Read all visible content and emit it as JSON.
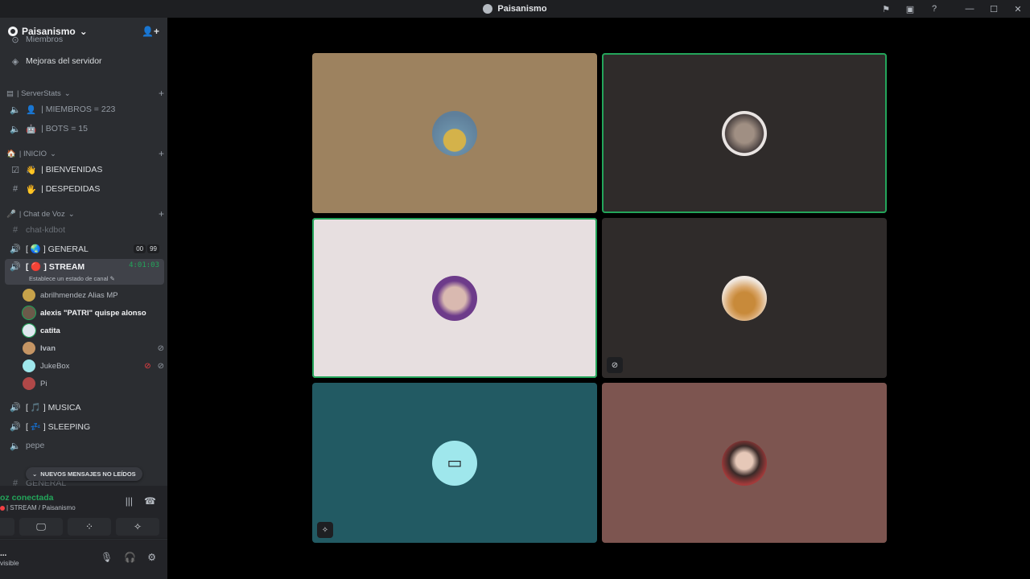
{
  "window": {
    "title": "Paisanismo"
  },
  "server": {
    "name": "Paisanismo"
  },
  "sidebar": {
    "partial_top": "Miembros",
    "boost": "Mejoras del servidor",
    "categories": {
      "serverstats": "| ServerStats",
      "inicio": "| INICIO",
      "chat_voz": "| Chat de Voz"
    },
    "channels": {
      "miembros": "| MIEMBROS = 223",
      "bots": "| BOTS = 15",
      "bienvenidas": "| BIENVENIDAS",
      "despedidas": "| DESPEDIDAS",
      "chat_kdbot": "chat-kdbot",
      "general": "[ 🌏 ] GENERAL",
      "general_badge_a": "00",
      "general_badge_b": "99",
      "stream": "[ 🔴 ] STREAM",
      "stream_timer": "4:01:03",
      "stream_status": "Establece un estado de canal",
      "musica": "[ 🎵 ] MUSICA",
      "sleeping": "[ 💤 ] SLEEPING",
      "pepe": "pepe",
      "general2": "GENERAL"
    },
    "voice_users": [
      {
        "name": "abrilhmendez Alias MP",
        "bold": false,
        "color": "#c7a24a"
      },
      {
        "name": "alexis \"PATRI\" quispe alonso",
        "bold": true,
        "color": "#6b5a4a"
      },
      {
        "name": "catita",
        "bold": true,
        "color": "#dfe7ef"
      },
      {
        "name": "Ivan",
        "bold": false,
        "color": "#c59564"
      },
      {
        "name": "JukeBox",
        "bold": false,
        "color": "#9fe7ec"
      },
      {
        "name": "Pi",
        "bold": false,
        "color": "#b04848"
      }
    ],
    "new_messages": "NUEVOS MENSAJES NO LEÍDOS"
  },
  "voice_panel": {
    "title": "oz conectada",
    "subtitle": "| STREAM / Paisanismo"
  },
  "user_panel": {
    "name": "...",
    "status": "visible"
  },
  "tiles": [
    {
      "bg": "#9d825f",
      "avatar": "#d4b24a",
      "speaking": false
    },
    {
      "bg": "#2f2b2a",
      "avatar": "#8a7a6e",
      "speaking": true
    },
    {
      "bg": "#e7dfe0",
      "avatar": "#d9b9b0",
      "speaking": true
    },
    {
      "bg": "#2f2b2a",
      "avatar": "#c88a3a",
      "speaking": false
    },
    {
      "bg": "#225a63",
      "avatar": "#9fe7ec",
      "speaking": false
    },
    {
      "bg": "#7d5550",
      "avatar": "#a33a3a",
      "speaking": false
    }
  ]
}
